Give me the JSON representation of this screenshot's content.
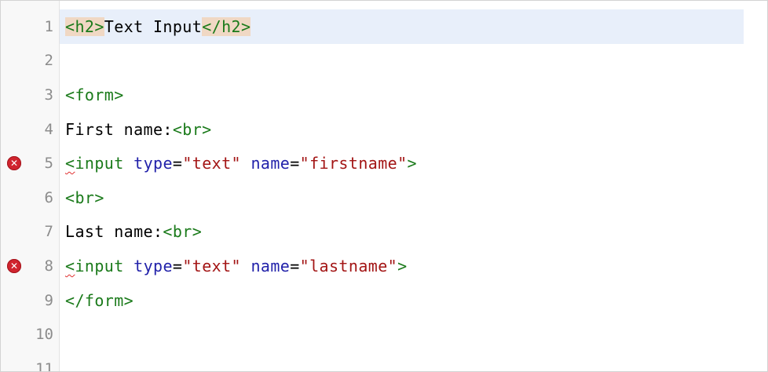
{
  "editor": {
    "lines": [
      {
        "number": "1",
        "active": true,
        "error": false,
        "tokens": [
          {
            "text": "<h2>",
            "kind": "tag-hl"
          },
          {
            "text": "Text Input",
            "kind": "text"
          },
          {
            "text": "</h2>",
            "kind": "tag-hl"
          }
        ]
      },
      {
        "number": "2",
        "active": false,
        "error": false,
        "tokens": []
      },
      {
        "number": "3",
        "active": false,
        "error": false,
        "tokens": [
          {
            "text": "<form>",
            "kind": "tag"
          }
        ]
      },
      {
        "number": "4",
        "active": false,
        "error": false,
        "tokens": [
          {
            "text": "First name:",
            "kind": "text"
          },
          {
            "text": "<br>",
            "kind": "tag"
          }
        ]
      },
      {
        "number": "5",
        "active": false,
        "error": true,
        "tokens": [
          {
            "text": "<",
            "kind": "tag",
            "squiggle": true
          },
          {
            "text": "input",
            "kind": "tag"
          },
          {
            "text": " ",
            "kind": "text"
          },
          {
            "text": "type",
            "kind": "attr"
          },
          {
            "text": "=",
            "kind": "text"
          },
          {
            "text": "\"text\"",
            "kind": "str"
          },
          {
            "text": " ",
            "kind": "text"
          },
          {
            "text": "name",
            "kind": "attr"
          },
          {
            "text": "=",
            "kind": "text"
          },
          {
            "text": "\"firstname\"",
            "kind": "str"
          },
          {
            "text": ">",
            "kind": "tag"
          }
        ]
      },
      {
        "number": "6",
        "active": false,
        "error": false,
        "tokens": [
          {
            "text": "<br>",
            "kind": "tag"
          }
        ]
      },
      {
        "number": "7",
        "active": false,
        "error": false,
        "tokens": [
          {
            "text": "Last name:",
            "kind": "text"
          },
          {
            "text": "<br>",
            "kind": "tag"
          }
        ]
      },
      {
        "number": "8",
        "active": false,
        "error": true,
        "tokens": [
          {
            "text": "<",
            "kind": "tag",
            "squiggle": true
          },
          {
            "text": "input",
            "kind": "tag"
          },
          {
            "text": " ",
            "kind": "text"
          },
          {
            "text": "type",
            "kind": "attr"
          },
          {
            "text": "=",
            "kind": "text"
          },
          {
            "text": "\"text\"",
            "kind": "str"
          },
          {
            "text": " ",
            "kind": "text"
          },
          {
            "text": "name",
            "kind": "attr"
          },
          {
            "text": "=",
            "kind": "text"
          },
          {
            "text": "\"lastname\"",
            "kind": "str"
          },
          {
            "text": ">",
            "kind": "tag"
          }
        ]
      },
      {
        "number": "9",
        "active": false,
        "error": false,
        "tokens": [
          {
            "text": "</form>",
            "kind": "tag"
          }
        ]
      },
      {
        "number": "10",
        "active": false,
        "error": false,
        "tokens": []
      },
      {
        "number": "11",
        "active": false,
        "error": false,
        "tokens": []
      }
    ],
    "error_glyph": "✕"
  },
  "colors": {
    "tag": "#1a7a1a",
    "attribute": "#2222aa",
    "string": "#a31515",
    "text": "#000000",
    "active_line": "#e8effa",
    "tag_highlight": "#f0d8c4",
    "error": "#d0242e"
  }
}
